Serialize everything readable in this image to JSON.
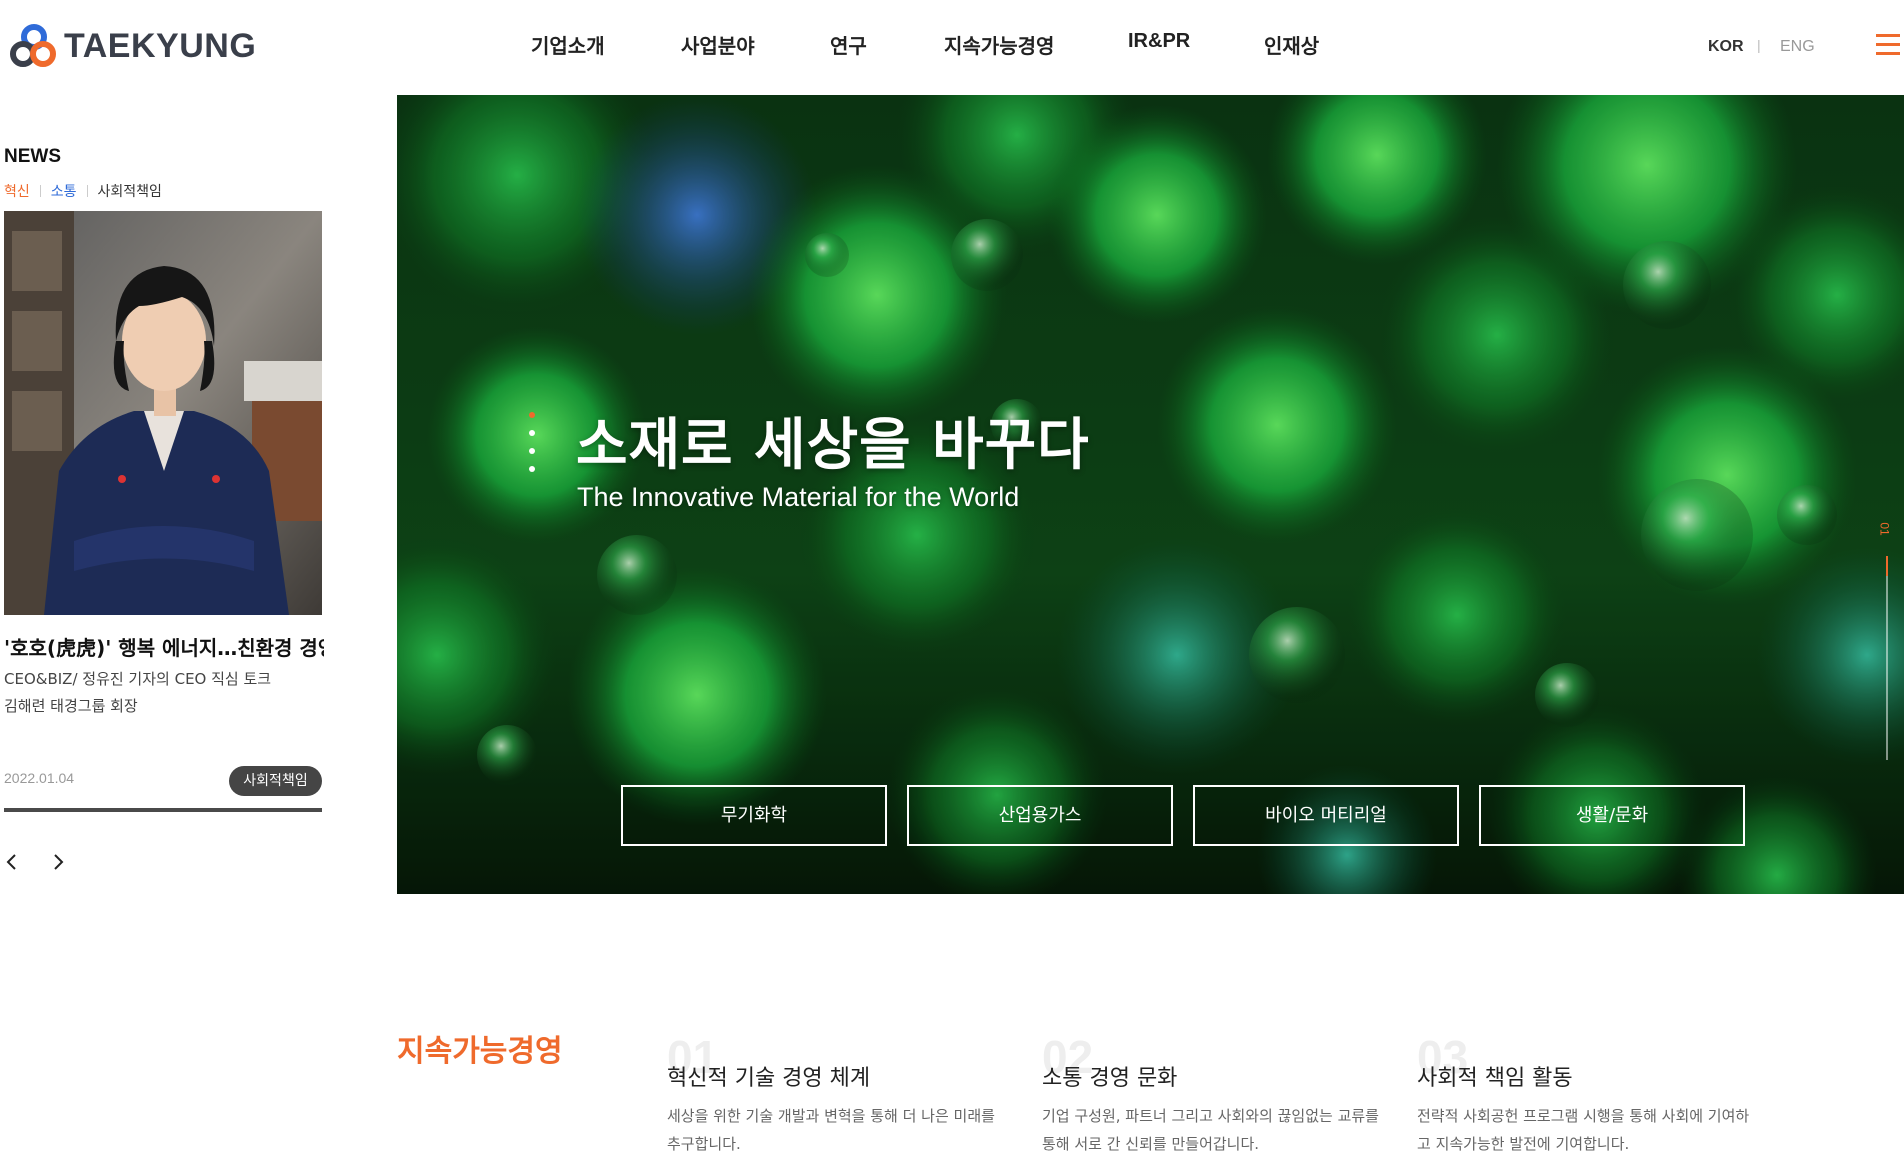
{
  "header": {
    "logo_text": "TAEKYUNG",
    "nav": [
      "기업소개",
      "사업분야",
      "연구",
      "지속가능경영",
      "IR&PR",
      "인재상"
    ],
    "lang_kor": "KOR",
    "lang_sep": "|",
    "lang_eng": "ENG",
    "menu_icon": "hamburger-menu-icon"
  },
  "news": {
    "title": "NEWS",
    "tabs": [
      {
        "label": "혁신",
        "color": "#ef6a2c"
      },
      {
        "label": "소통",
        "color": "#2f6bd8"
      },
      {
        "label": "사회적책임",
        "color": "#333333"
      }
    ],
    "headline": "'호호(虎虎)' 행복 에너지…친환경 경영...",
    "desc_line1": "CEO&BIZ/ 정유진 기자의 CEO 직심 토크",
    "desc_line2": "김해련 태경그룹 회장",
    "date": "2022.01.04",
    "badge": "사회적책임",
    "prev_icon": "chevron-left-icon",
    "next_icon": "chevron-right-icon"
  },
  "hero": {
    "title": "소재로 세상을 바꾸다",
    "subtitle": "The Innovative Material for the World",
    "buttons": [
      "무기화학",
      "산업용가스",
      "바이오 머티리얼",
      "생활/문화"
    ],
    "slide_number": "01",
    "accent_color": "#ef6a2c"
  },
  "sustainability": {
    "title": "지속가능경영",
    "items": [
      {
        "num": "01",
        "title": "혁신적 기술 경영 체계",
        "text": "세상을 위한 기술 개발과 변혁을 통해 더 나은 미래를 추구합니다."
      },
      {
        "num": "02",
        "title": "소통 경영 문화",
        "text": "기업 구성원, 파트너 그리고 사회와의 끊임없는 교류를 통해 서로 간 신뢰를 만들어갑니다."
      },
      {
        "num": "03",
        "title": "사회적 책임 활동",
        "text": "전략적 사회공헌 프로그램 시행을 통해 사회에 기여하고 지속가능한 발전에 기여합니다."
      }
    ]
  }
}
